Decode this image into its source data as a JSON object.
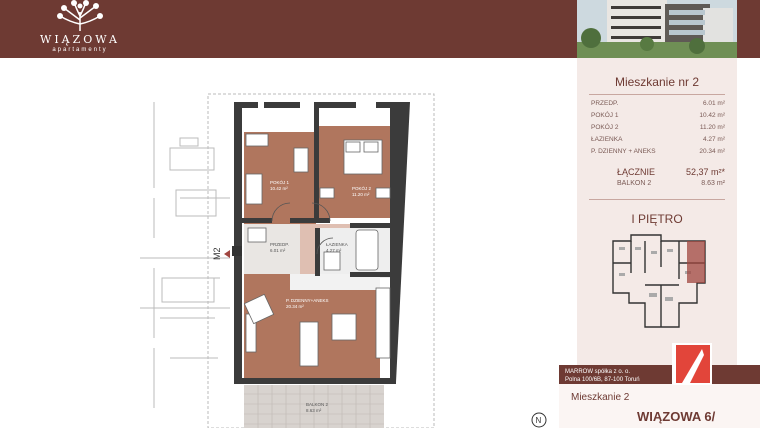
{
  "brand": {
    "name": "WIĄZOWA",
    "tagline": "apartamenty"
  },
  "unit_panel": {
    "title": "Mieszkanie nr 2",
    "rooms": [
      {
        "label": "PRZEDP.",
        "area": "6.01 m²"
      },
      {
        "label": "POKÓJ 1",
        "area": "10.42 m²"
      },
      {
        "label": "POKÓJ 2",
        "area": "11.20 m²"
      },
      {
        "label": "ŁAZIENKA",
        "area": "4.27 m²"
      },
      {
        "label": "P. DZIENNY + ANEKS",
        "area": "20.34 m²"
      }
    ],
    "total_label": "ŁĄCZNIE",
    "total_area": "52,37 m²*",
    "balcony_label": "BALKON 2",
    "balcony_area": "8.63 m²",
    "floor": "I PIĘTRO"
  },
  "plan": {
    "pokoj1": "POKÓJ 1",
    "pokoj1_area": "10.42 m²",
    "pokoj2": "POKÓJ 2",
    "pokoj2_area": "11.20 m²",
    "przedp": "PRZEDP.",
    "przedp_area": "6.01 m²",
    "lazienka": "ŁAZIENKA",
    "lazienka_area": "4.27 m²",
    "dzienny": "P. DZIENNY+ANEKS",
    "dzienny_area": "20.34 m²",
    "balkon": "BALKON 2",
    "balkon_area": "8.63 m²",
    "tag": "M2",
    "compass": "N"
  },
  "footer": {
    "company": "MARROW spółka z o. o.",
    "address": "Polna 100/6B, 87-100 Toruń",
    "unit": "Mieszkanie 2",
    "building": "WIĄZOWA 6/"
  },
  "colors": {
    "brand": "#6e3a33",
    "floor": "#b0765e",
    "highlight": "#a0453f",
    "panel": "#f4eae7"
  }
}
